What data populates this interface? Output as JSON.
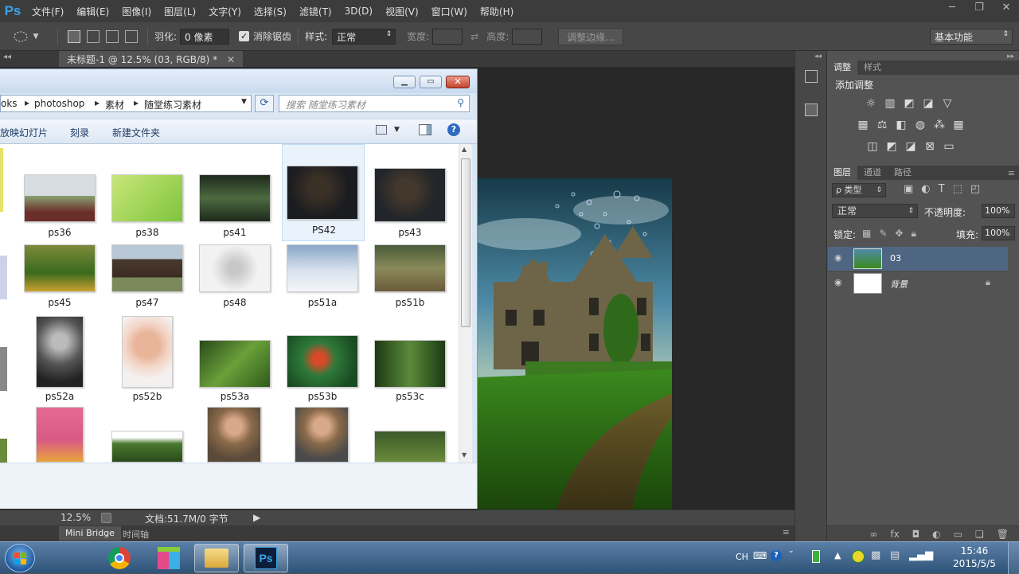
{
  "photoshop": {
    "logo": "Ps",
    "menu": [
      "文件(F)",
      "编辑(E)",
      "图像(I)",
      "图层(L)",
      "文字(Y)",
      "选择(S)",
      "滤镜(T)",
      "3D(D)",
      "视图(V)",
      "窗口(W)",
      "帮助(H)"
    ],
    "window_controls": [
      "─",
      "❐",
      "✕"
    ],
    "options": {
      "feather_label": "羽化:",
      "feather_value": "0 像素",
      "antialias_label": "消除锯齿",
      "style_label": "样式:",
      "style_value": "正常",
      "width_label": "宽度:",
      "height_label": "高度:",
      "refine_edge": "调整边缘...",
      "workspace": "基本功能"
    },
    "document_tab": "未标题-1 @ 12.5% (03, RGB/8) *",
    "status": {
      "zoom": "12.5%",
      "doc_info": "文档:51.7M/0 字节"
    },
    "bottom_tabs": [
      "Mini Bridge",
      "时间轴"
    ],
    "adjustments": {
      "tabs": [
        "调整",
        "样式"
      ],
      "heading": "添加调整"
    },
    "layers": {
      "tabs": [
        "图层",
        "通道",
        "路径"
      ],
      "filter_kind": "ρ 类型",
      "blend_mode": "正常",
      "opacity_label": "不透明度:",
      "opacity_value": "100%",
      "lock_label": "锁定:",
      "fill_label": "填充:",
      "fill_value": "100%",
      "items": [
        {
          "name": "03",
          "selected": true
        },
        {
          "name": "背景",
          "selected": false
        }
      ]
    }
  },
  "explorer": {
    "path": [
      "oks",
      "photoshop",
      "素材",
      "随堂练习素材"
    ],
    "search_placeholder": "搜索 随堂练习素材",
    "toolbar": [
      "放映幻灯片",
      "刻录",
      "新建文件夹"
    ],
    "thumbnails": [
      [
        "ps36",
        "ps38",
        "ps41",
        "PS42",
        "ps43"
      ],
      [
        "ps45",
        "ps47",
        "ps48",
        "ps51a",
        "ps51b"
      ],
      [
        "ps52a",
        "ps52b",
        "ps53a",
        "ps53b",
        "ps53c"
      ]
    ],
    "selected": "PS42"
  },
  "taskbar": {
    "lang": "CH",
    "time": "15:46",
    "date": "2015/5/5"
  },
  "colors": {
    "ps_dark": "#282828",
    "ps_panel": "#535353",
    "layer_selected": "#4f6683",
    "taskbar": "#2f5377"
  }
}
